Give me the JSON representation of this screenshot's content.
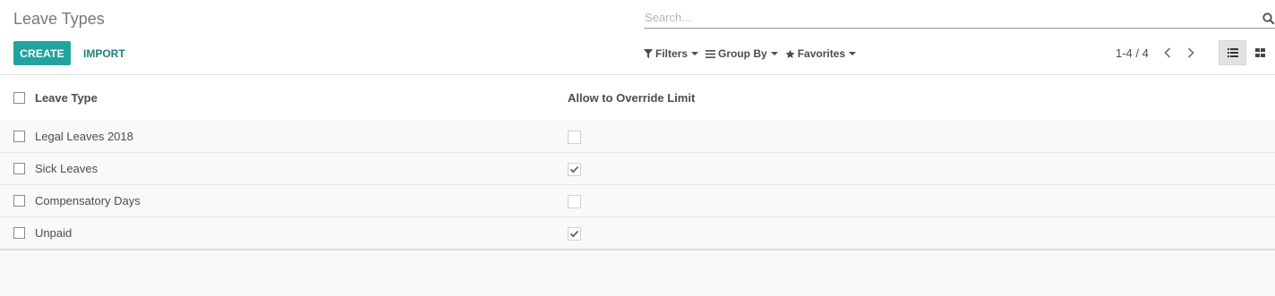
{
  "breadcrumb": {
    "title": "Leave Types"
  },
  "search": {
    "placeholder": "Search...",
    "icon": "search-icon"
  },
  "buttons": {
    "create": "CREATE",
    "import": "IMPORT"
  },
  "search_options": {
    "filters": "Filters",
    "group_by": "Group By",
    "favorites": "Favorites"
  },
  "pager": {
    "value": "1-4 / 4"
  },
  "views": {
    "active": "list"
  },
  "colors": {
    "primary": "#21a3a0",
    "link": "#1f7f7c",
    "text": "#4c4c4c"
  },
  "table": {
    "columns": [
      "Leave Type",
      "Allow to Override Limit"
    ],
    "rows": [
      {
        "name": "Legal Leaves 2018",
        "allow_override": false
      },
      {
        "name": "Sick Leaves",
        "allow_override": true
      },
      {
        "name": "Compensatory Days",
        "allow_override": false
      },
      {
        "name": "Unpaid",
        "allow_override": true
      }
    ]
  }
}
